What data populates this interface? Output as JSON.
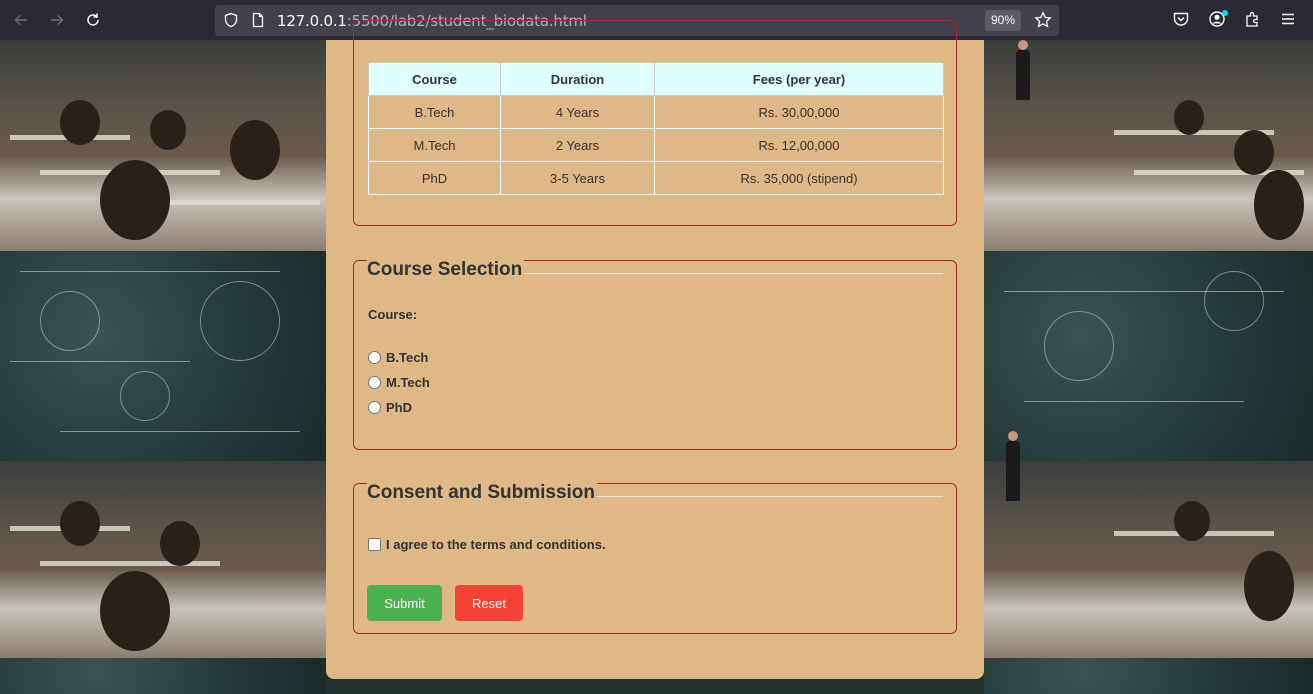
{
  "browser": {
    "url_host": "127.0.0.1",
    "url_rest": ":5500/lab2/student_biodata.html",
    "zoom": "90%"
  },
  "fees_table": {
    "headers": [
      "Course",
      "Duration",
      "Fees (per year)"
    ],
    "rows": [
      [
        "B.Tech",
        "4 Years",
        "Rs. 30,00,000"
      ],
      [
        "M.Tech",
        "2 Years",
        "Rs. 12,00,000"
      ],
      [
        "PhD",
        "3-5 Years",
        "Rs. 35,000 (stipend)"
      ]
    ]
  },
  "course_selection": {
    "legend": "Course Selection",
    "label": "Course:",
    "options": [
      "B.Tech",
      "M.Tech",
      "PhD"
    ]
  },
  "consent": {
    "legend": "Consent and Submission",
    "agree_label": "I agree to the terms and conditions.",
    "submit_label": "Submit",
    "reset_label": "Reset"
  },
  "colors": {
    "form_bg": "#deb887",
    "border": "#a52a2a",
    "header_bg": "#e0ffff",
    "submit": "#4caf50",
    "reset": "#f44336"
  }
}
